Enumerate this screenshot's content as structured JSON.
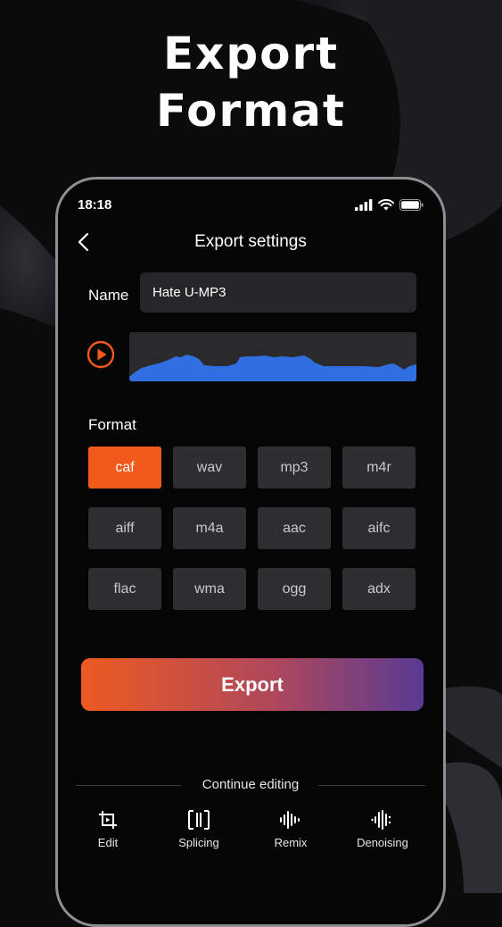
{
  "headline": {
    "line1": "Export",
    "line2": "Format"
  },
  "status_bar": {
    "time": "18:18"
  },
  "nav": {
    "title": "Export settings"
  },
  "name_field": {
    "label": "Name",
    "value": "Hate U-MP3"
  },
  "format_section": {
    "label": "Format",
    "selected": "caf",
    "options": [
      "caf",
      "wav",
      "mp3",
      "m4r",
      "aiff",
      "m4a",
      "aac",
      "aifc",
      "flac",
      "wma",
      "ogg",
      "adx"
    ]
  },
  "export_button": {
    "label": "Export"
  },
  "continue_editing": {
    "label": "Continue editing"
  },
  "tools": [
    {
      "label": "Edit",
      "icon": "crop-edit-icon"
    },
    {
      "label": "Splicing",
      "icon": "splicing-icon"
    },
    {
      "label": "Remix",
      "icon": "remix-icon"
    },
    {
      "label": "Denoising",
      "icon": "denoising-icon"
    }
  ],
  "colors": {
    "accent": "#f25a1c",
    "waveform": "#2f6fe0",
    "export_gradient_start": "#ee5a21",
    "export_gradient_end": "#5a3a93"
  }
}
